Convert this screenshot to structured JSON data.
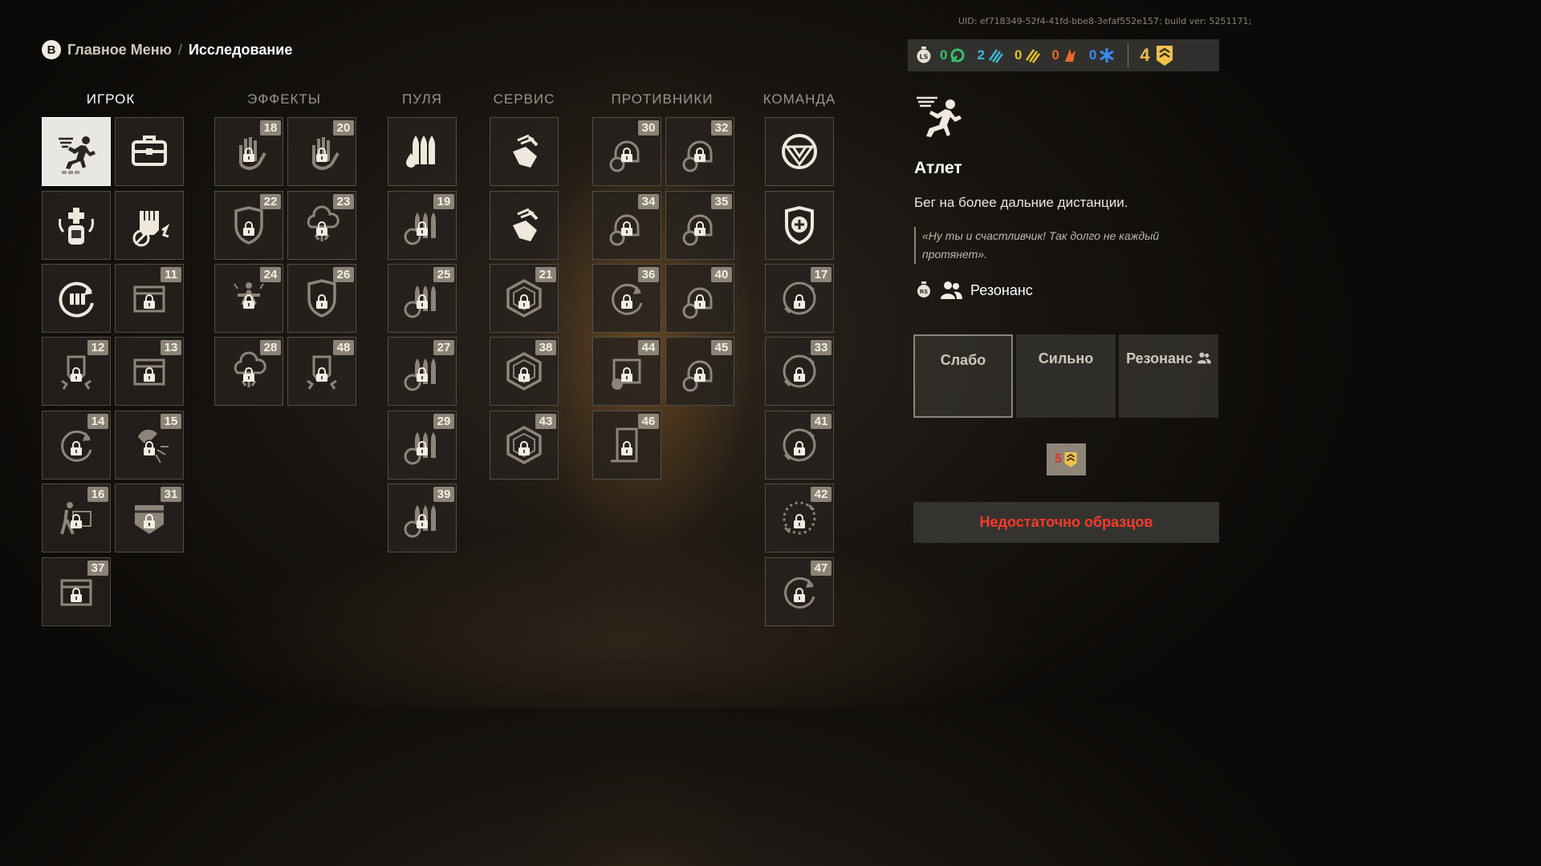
{
  "uid_text": "UID: ef718349-52f4-41fd-bbe8-3efaf552e157; build ver: 5251171;",
  "breadcrumb": {
    "button_key": "B",
    "previous": "Главное Меню",
    "separator": "/",
    "current": "Исследование"
  },
  "columns": [
    "ИГРОК",
    "ЭФФЕКТЫ",
    "ПУЛЯ",
    "СЕРВИС",
    "ПРОТИВНИКИ",
    "КОМАНДА"
  ],
  "resources": {
    "items": [
      {
        "value": "0",
        "color": "#39c06a",
        "icon": "green-swirl-icon"
      },
      {
        "value": "2",
        "color": "#3ab9d9",
        "icon": "cyan-stripes-icon"
      },
      {
        "value": "0",
        "color": "#e4c21f",
        "icon": "yellow-stripes-icon"
      },
      {
        "value": "0",
        "color": "#e96a2a",
        "icon": "orange-flame-icon"
      },
      {
        "value": "0",
        "color": "#3a8bff",
        "icon": "blue-snowflake-icon"
      }
    ],
    "samples": "4"
  },
  "grid": {
    "player": [
      {
        "icon": "sprinter-icon",
        "num": ""
      },
      {
        "icon": "toolbox-icon",
        "num": ""
      },
      {
        "icon": "medkit-icon",
        "num": ""
      },
      {
        "icon": "fist-icon",
        "num": ""
      },
      {
        "icon": "reload-ammo-icon",
        "num": ""
      },
      {
        "icon": "ammo-box-icon",
        "num": "11"
      },
      {
        "icon": "fist-lock-icon",
        "num": "12"
      },
      {
        "icon": "locker-icon",
        "num": "13"
      },
      {
        "icon": "cycle-lock-icon",
        "num": "14"
      },
      {
        "icon": "magnet-icon",
        "num": "15"
      },
      {
        "icon": "runner-box-icon",
        "num": "16"
      },
      {
        "icon": "shield-pocket-icon",
        "num": "31"
      },
      {
        "icon": "chest-icon",
        "num": "37"
      }
    ],
    "effects": [
      {
        "icon": "hand-lock-icon",
        "num": "18"
      },
      {
        "icon": "hand-lock-icon",
        "num": "20"
      },
      {
        "icon": "shield-lock-icon",
        "num": "22"
      },
      {
        "icon": "cloud-burst-icon",
        "num": "23"
      },
      {
        "icon": "burst-figure-icon",
        "num": "24"
      },
      {
        "icon": "shield-lock-icon",
        "num": "26"
      },
      {
        "icon": "cloud-drop-icon",
        "num": "28"
      },
      {
        "icon": "fist-burst-icon",
        "num": "48"
      }
    ],
    "bullet": [
      {
        "icon": "bullets-drop-icon",
        "num": ""
      },
      {
        "icon": "bullets-play-icon",
        "num": "19"
      },
      {
        "icon": "bullets-circle-icon",
        "num": "25"
      },
      {
        "icon": "bullets-bolt-icon",
        "num": "27"
      },
      {
        "icon": "bullets-target-icon",
        "num": "29"
      },
      {
        "icon": "bullets-snow-icon",
        "num": "39"
      }
    ],
    "service": [
      {
        "icon": "hand-wrench-icon",
        "num": ""
      },
      {
        "icon": "hand-tools-icon",
        "num": ""
      },
      {
        "icon": "hex-lock-icon",
        "num": "21"
      },
      {
        "icon": "hex-lock-icon",
        "num": "38"
      },
      {
        "icon": "hex-lock-icon",
        "num": "43"
      }
    ],
    "enemies": [
      {
        "icon": "enemy-network-icon",
        "num": "30"
      },
      {
        "icon": "enemy-drop-icon",
        "num": "32"
      },
      {
        "icon": "enemy-target-icon",
        "num": "34"
      },
      {
        "icon": "enemy-play-icon",
        "num": "35"
      },
      {
        "icon": "enemy-cycle-icon",
        "num": "36"
      },
      {
        "icon": "enemy-network-icon",
        "num": "40"
      },
      {
        "icon": "enemy-screen-icon",
        "num": "44"
      },
      {
        "icon": "enemy-snow-icon",
        "num": "45"
      },
      {
        "icon": "door-lock-icon",
        "num": "46"
      }
    ],
    "team": [
      {
        "icon": "team-emblem-icon",
        "num": ""
      },
      {
        "icon": "team-shield-icon",
        "num": ""
      },
      {
        "icon": "circle-lock-icon",
        "num": "17"
      },
      {
        "icon": "circle-arrows-icon",
        "num": "33"
      },
      {
        "icon": "circle-shield-icon",
        "num": "41"
      },
      {
        "icon": "circle-play-icon",
        "num": "42"
      },
      {
        "icon": "circle-cycle-icon",
        "num": "47"
      }
    ]
  },
  "detail": {
    "icon": "sprinter-icon",
    "title": "Атлет",
    "description": "Бег на более дальние дистанции.",
    "quote": "«Ну ты и счастливчик! Так долго не каждый протянет».",
    "tag_icon": "resonance-stopwatch-icon",
    "tag_label": "Резонанс",
    "modes": [
      "Слабо",
      "Сильно",
      "Резонанс"
    ],
    "cost": "5",
    "button_label": "Недостаточно образцов"
  }
}
